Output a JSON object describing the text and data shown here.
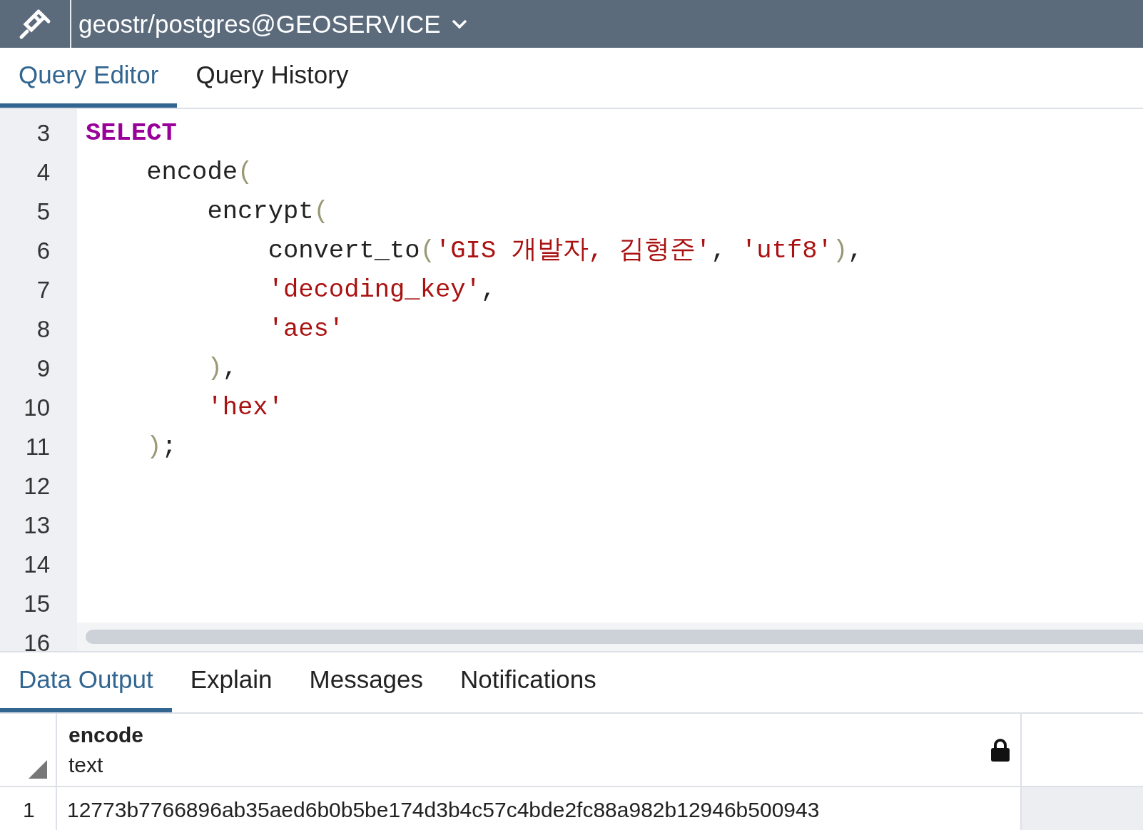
{
  "connection": {
    "title": "geostr/postgres@GEOSERVICE"
  },
  "editor_tabs": [
    {
      "label": "Query Editor",
      "selected": true
    },
    {
      "label": "Query History",
      "selected": false
    }
  ],
  "code_lines": [
    {
      "number": "3",
      "tokens": [
        {
          "kind": "keyword",
          "text": "SELECT"
        }
      ]
    },
    {
      "number": "4",
      "tokens": [
        {
          "kind": "plain",
          "text": "    encode"
        },
        {
          "kind": "paren",
          "text": "("
        }
      ]
    },
    {
      "number": "5",
      "tokens": [
        {
          "kind": "plain",
          "text": "        encrypt"
        },
        {
          "kind": "paren",
          "text": "("
        }
      ]
    },
    {
      "number": "6",
      "tokens": [
        {
          "kind": "plain",
          "text": "            convert_to"
        },
        {
          "kind": "paren",
          "text": "("
        },
        {
          "kind": "string",
          "text": "'GIS 개발자, 김형준'"
        },
        {
          "kind": "plain",
          "text": ", "
        },
        {
          "kind": "string",
          "text": "'utf8'"
        },
        {
          "kind": "paren",
          "text": ")"
        },
        {
          "kind": "plain",
          "text": ","
        }
      ]
    },
    {
      "number": "7",
      "tokens": [
        {
          "kind": "string",
          "text": "            'decoding_key'"
        },
        {
          "kind": "plain",
          "text": ","
        }
      ]
    },
    {
      "number": "8",
      "tokens": [
        {
          "kind": "string",
          "text": "            'aes'"
        }
      ]
    },
    {
      "number": "9",
      "tokens": [
        {
          "kind": "paren",
          "text": "        )"
        },
        {
          "kind": "plain",
          "text": ","
        }
      ]
    },
    {
      "number": "10",
      "tokens": [
        {
          "kind": "string",
          "text": "        'hex'"
        }
      ]
    },
    {
      "number": "11",
      "tokens": [
        {
          "kind": "paren",
          "text": "    )"
        },
        {
          "kind": "plain",
          "text": ";"
        }
      ]
    },
    {
      "number": "12"
    },
    {
      "number": "13"
    },
    {
      "number": "14"
    },
    {
      "number": "15"
    },
    {
      "number": "16"
    }
  ],
  "output_tabs": [
    {
      "label": "Data Output",
      "selected": true
    },
    {
      "label": "Explain",
      "selected": false
    },
    {
      "label": "Messages",
      "selected": false
    },
    {
      "label": "Notifications",
      "selected": false
    }
  ],
  "result_grid": {
    "columns": [
      {
        "name": "encode",
        "type": "text"
      }
    ],
    "rows": [
      {
        "number": "1",
        "cells": [
          "12773b7766896ab35aed6b0b5be174d3b4c57c4bde2fc88a982b12946b500943"
        ]
      }
    ]
  }
}
